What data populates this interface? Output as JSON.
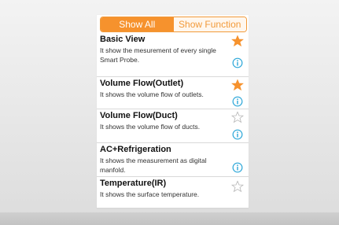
{
  "tabs": [
    {
      "label": "Show All",
      "active": true
    },
    {
      "label": "Show Function",
      "active": false
    }
  ],
  "items": [
    {
      "title": "Basic View",
      "description": "It show the mesurement of every single Smart Probe.",
      "starred": true,
      "has_star": true,
      "has_info": true
    },
    {
      "title": "Volume Flow(Outlet)",
      "description": "It shows the volume flow of outlets.",
      "starred": true,
      "has_star": true,
      "has_info": true
    },
    {
      "title": "Volume Flow(Duct)",
      "description": "It shows the volume flow of ducts.",
      "starred": false,
      "has_star": true,
      "has_info": true
    },
    {
      "title": "AC+Refrigeration",
      "description": "It shows the measurement as digital manfold.",
      "starred": false,
      "has_star": false,
      "has_info": true
    },
    {
      "title": "Temperature(IR)",
      "description": "It shows the surface temperature.",
      "starred": false,
      "has_star": true,
      "has_info": false
    }
  ],
  "colors": {
    "accent": "#f6922d",
    "star_filled": "#f6922d",
    "star_empty": "#b5b5b5",
    "info": "#2aa6d8"
  },
  "icons": {
    "star": "star-icon",
    "info": "info-icon"
  }
}
